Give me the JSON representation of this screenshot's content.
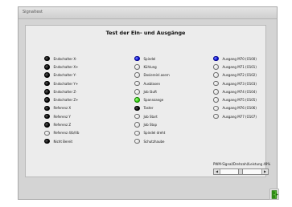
{
  "window": {
    "title": "Signaltest"
  },
  "heading": "Test der Ein- und Ausgänge",
  "columns": [
    [
      {
        "label": "Endschalter X-",
        "state": "black"
      },
      {
        "label": "Endschalter X+",
        "state": "black"
      },
      {
        "label": "Endschalter Y-",
        "state": "black"
      },
      {
        "label": "Endschalter Y+",
        "state": "black"
      },
      {
        "label": "Endschalter Z-",
        "state": "black"
      },
      {
        "label": "Endschalter Z+",
        "state": "black"
      },
      {
        "label": "Referenz X",
        "state": "black"
      },
      {
        "label": "Referenz Y",
        "state": "black"
      },
      {
        "label": "Referenz Z",
        "state": "black"
      },
      {
        "label": "Referenz 4/b/Vb",
        "state": "off"
      },
      {
        "label": "Nicht Bereit",
        "state": "black"
      }
    ],
    [
      {
        "label": "Spindel",
        "state": "blue"
      },
      {
        "label": "Kühlung",
        "state": "off"
      },
      {
        "label": "Dosiereinl.asern",
        "state": "off"
      },
      {
        "label": "Ausblasen",
        "state": "off"
      },
      {
        "label": "Job läuft",
        "state": "off"
      },
      {
        "label": "Spannzange",
        "state": "green"
      },
      {
        "label": "Taster",
        "state": "black"
      },
      {
        "label": "Job Start",
        "state": "off"
      },
      {
        "label": "Job Stop",
        "state": "off"
      },
      {
        "label": "Spindel dreht",
        "state": "off"
      },
      {
        "label": "Schutzhaube",
        "state": "off"
      }
    ],
    [
      {
        "label": "Ausgang M70 (O100)",
        "state": "blue"
      },
      {
        "label": "Ausgang M71 (O101)",
        "state": "off"
      },
      {
        "label": "Ausgang M72 (O102)",
        "state": "off"
      },
      {
        "label": "Ausgang M73 (O103)",
        "state": "off"
      },
      {
        "label": "Ausgang M74 (O104)",
        "state": "off"
      },
      {
        "label": "Ausgang M75 (O105)",
        "state": "off"
      },
      {
        "label": "Ausgang M76 (O106)",
        "state": "off"
      },
      {
        "label": "Ausgang M77 (O107)",
        "state": "off"
      }
    ]
  ],
  "pwm": {
    "label": "PWM-Signal/Drehzahl/Leistung  49%",
    "value_percent": 49
  },
  "exit_button": {
    "icon": "exit-door-icon",
    "color": "#3a9a1c"
  },
  "colors": {
    "blue": "#0000cc",
    "green": "#22c400",
    "black": "#000000"
  }
}
